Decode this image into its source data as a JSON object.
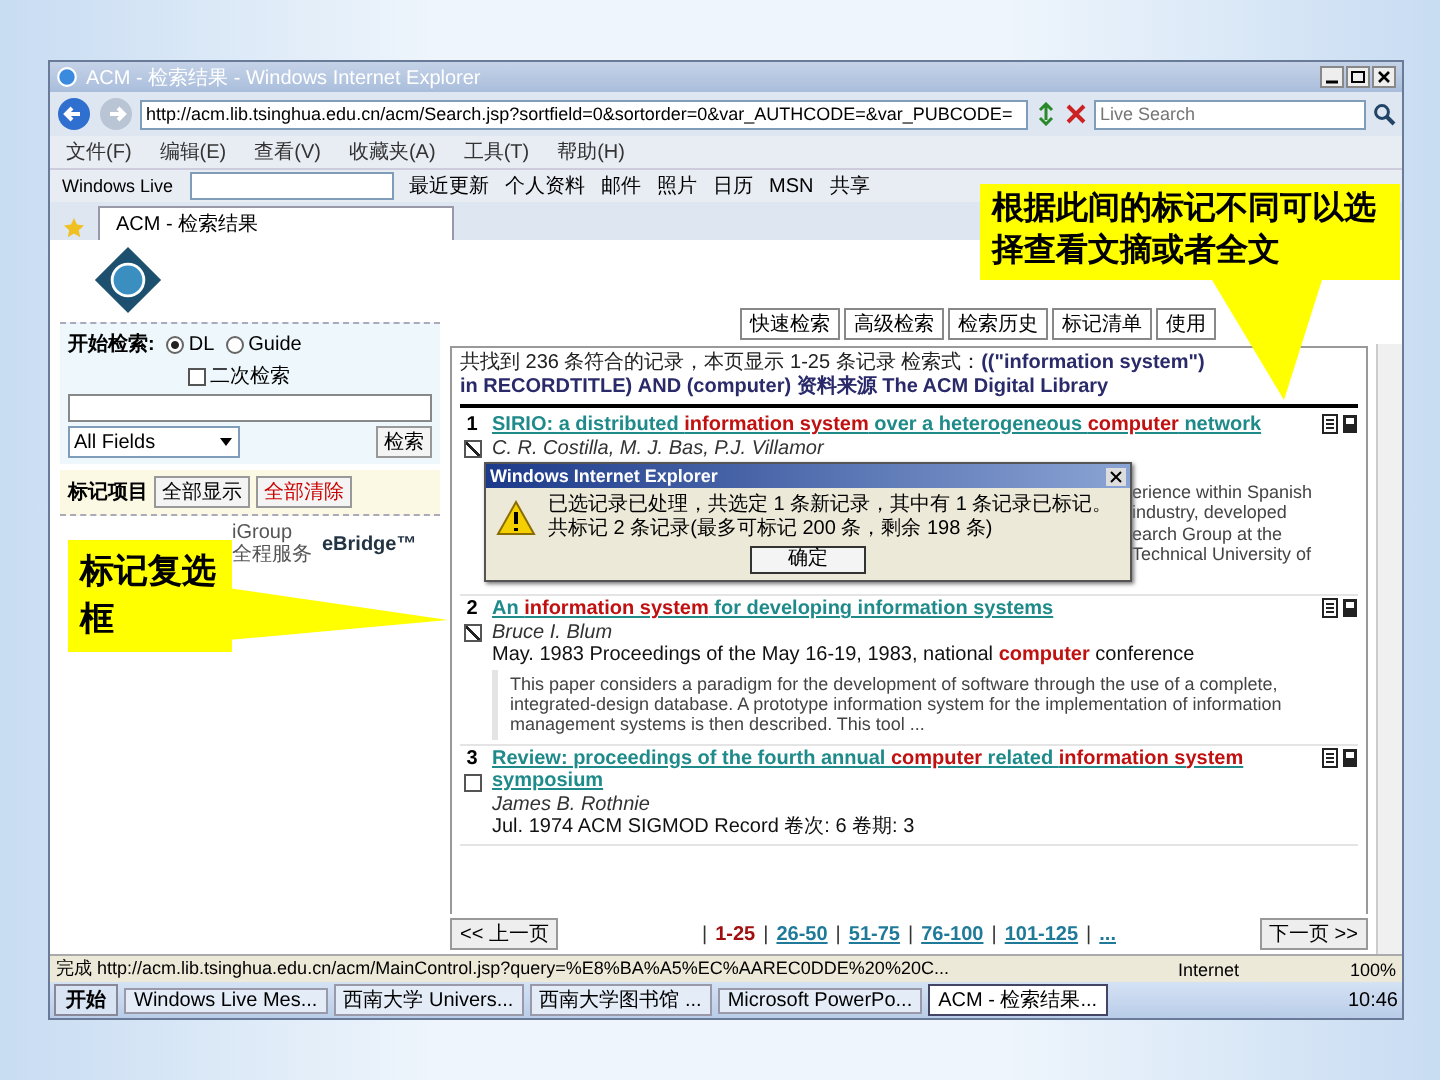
{
  "browser": {
    "title": "ACM - 检索结果 - Windows Internet Explorer",
    "address": "http://acm.lib.tsinghua.edu.cn/acm/Search.jsp?sortfield=0&sortorder=0&var_AUTHCODE=&var_PUBCODE=",
    "search_placeholder": "Live Search",
    "menu": [
      "文件(F)",
      "编辑(E)",
      "查看(V)",
      "收藏夹(A)",
      "工具(T)",
      "帮助(H)"
    ],
    "links_brand": "Windows Live",
    "links": [
      "最近更新",
      "个人资料",
      "邮件",
      "照片",
      "日历",
      "MSN",
      "共享"
    ],
    "tab": "ACM - 检索结果"
  },
  "sidebar": {
    "search_label": "开始检索:",
    "sources": [
      {
        "label": "DL",
        "selected": true
      },
      {
        "label": "Guide",
        "selected": false
      }
    ],
    "refine": {
      "label": "二次检索",
      "checked": false
    },
    "field_select": "All Fields",
    "search_button": "检索",
    "marked_label": "标记项目",
    "marked_buttons": [
      "全部显示",
      "全部清除"
    ],
    "partner": [
      "iGroup",
      "全程服务"
    ],
    "ebridge": "eBridge™"
  },
  "nav_buttons": [
    "快速检索",
    "高级检索",
    "检索历史",
    "标记清单",
    "使用"
  ],
  "results": {
    "summary": "共找到 236 条符合的记录，本页显示 1-25 条记录 检索式：",
    "query": "((\"information system\") in RECORDTITLE) AND (computer) 资料来源 The ACM Digital Library",
    "items": [
      {
        "number": "1",
        "title": "SIRIO: a distributed **information system** over a heterogeneous **computer** network",
        "checked": true,
        "authors": "C. R. Costilla, M. J. Bas, P.J. Villamor",
        "abstract": [
          "erience within Spanish industry, developed",
          "earch Group at the Technical University of"
        ]
      },
      {
        "number": "2",
        "title": "An **information system** for developing information systems",
        "checked": true,
        "authors": "Bruce I. Blum",
        "source": "May. 1983 Proceedings of the May 16-19, 1983, national **computer** conference",
        "abstract": [
          "This paper considers a paradigm for the development of software through the use of a complete, integrated-design database. A prototype information system for the implementation of information management systems is then described. This tool ..."
        ]
      },
      {
        "number": "3",
        "title": "Review: proceedings of the fourth annual **computer** related **information system** symposium",
        "checked": false,
        "authors": "James B. Rothnie",
        "source": "Jul. 1974 ACM SIGMOD Record 卷次: 6 卷期: 3"
      }
    ]
  },
  "pager": {
    "prev": "<< 上一页",
    "separator": "|",
    "pages": [
      {
        "label": "1-25",
        "selected": true
      },
      {
        "label": "26-50",
        "selected": false
      },
      {
        "label": "51-75",
        "selected": false
      },
      {
        "label": "76-100",
        "selected": false
      },
      {
        "label": "101-125",
        "selected": false
      },
      {
        "label": "...",
        "selected": false
      }
    ],
    "next": "下一页 >>"
  },
  "status_bar": {
    "text": "完成 http://acm.lib.tsinghua.edu.cn/acm/MainControl.jsp?query=%E8%BA%A5%EC%AAREC0DDE%20%20C...",
    "zone": "Internet",
    "zoom": "100%"
  },
  "dialog": {
    "title": "Windows Internet Explorer",
    "message": [
      "已选记录已处理，共选定 1 条新记录，其中有 1 条记录已标记。",
      "共标记 2 条记录(最多可标记 200 条，剩余 198 条)"
    ],
    "button": "确定"
  },
  "taskbar": {
    "start": "开始",
    "tasks": [
      {
        "label": "Windows Live Mes...",
        "selected": false
      },
      {
        "label": "西南大学 Univers...",
        "selected": false
      },
      {
        "label": "西南大学图书馆 ...",
        "selected": false
      },
      {
        "label": "Microsoft PowerPo...",
        "selected": false
      },
      {
        "label": "ACM - 检索结果...",
        "selected": true
      }
    ],
    "clock": "10:46"
  },
  "callouts": [
    {
      "text": "根据此间的标记不同可以选择查看文摘或者全文"
    },
    {
      "text": "标记复选框"
    }
  ]
}
